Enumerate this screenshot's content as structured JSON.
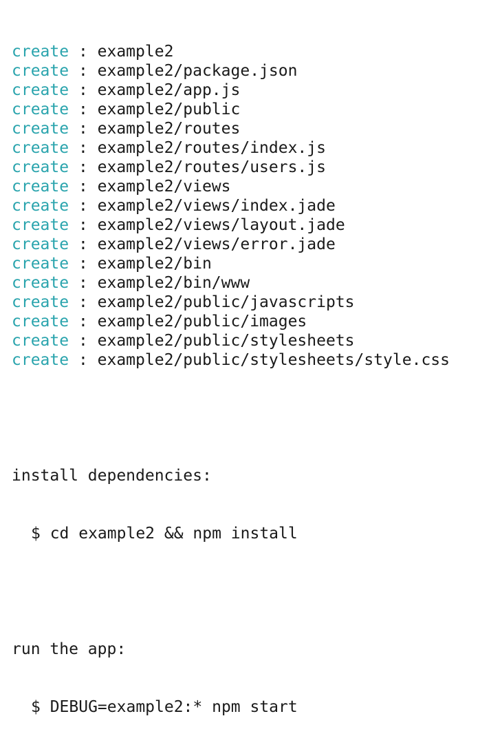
{
  "terminal": {
    "colors": {
      "verb": "#2aa4ad",
      "text": "#1a1a1a",
      "background": "#ffffff"
    },
    "created_lines": [
      {
        "verb": "create",
        "separator": " : ",
        "path": "example2"
      },
      {
        "verb": "create",
        "separator": " : ",
        "path": "example2/package.json"
      },
      {
        "verb": "create",
        "separator": " : ",
        "path": "example2/app.js"
      },
      {
        "verb": "create",
        "separator": " : ",
        "path": "example2/public"
      },
      {
        "verb": "create",
        "separator": " : ",
        "path": "example2/routes"
      },
      {
        "verb": "create",
        "separator": " : ",
        "path": "example2/routes/index.js"
      },
      {
        "verb": "create",
        "separator": " : ",
        "path": "example2/routes/users.js"
      },
      {
        "verb": "create",
        "separator": " : ",
        "path": "example2/views"
      },
      {
        "verb": "create",
        "separator": " : ",
        "path": "example2/views/index.jade"
      },
      {
        "verb": "create",
        "separator": " : ",
        "path": "example2/views/layout.jade"
      },
      {
        "verb": "create",
        "separator": " : ",
        "path": "example2/views/error.jade"
      },
      {
        "verb": "create",
        "separator": " : ",
        "path": "example2/bin"
      },
      {
        "verb": "create",
        "separator": " : ",
        "path": "example2/bin/www"
      },
      {
        "verb": "create",
        "separator": " : ",
        "path": "example2/public/javascripts"
      },
      {
        "verb": "create",
        "separator": " : ",
        "path": "example2/public/images"
      },
      {
        "verb": "create",
        "separator": " : ",
        "path": "example2/public/stylesheets"
      },
      {
        "verb": "create",
        "separator": " : ",
        "path": "example2/public/stylesheets/style.css"
      }
    ],
    "install": {
      "heading": "install dependencies:",
      "command": "$ cd example2 && npm install"
    },
    "run": {
      "heading": "run the app:",
      "command": "$ DEBUG=example2:* npm start"
    }
  }
}
